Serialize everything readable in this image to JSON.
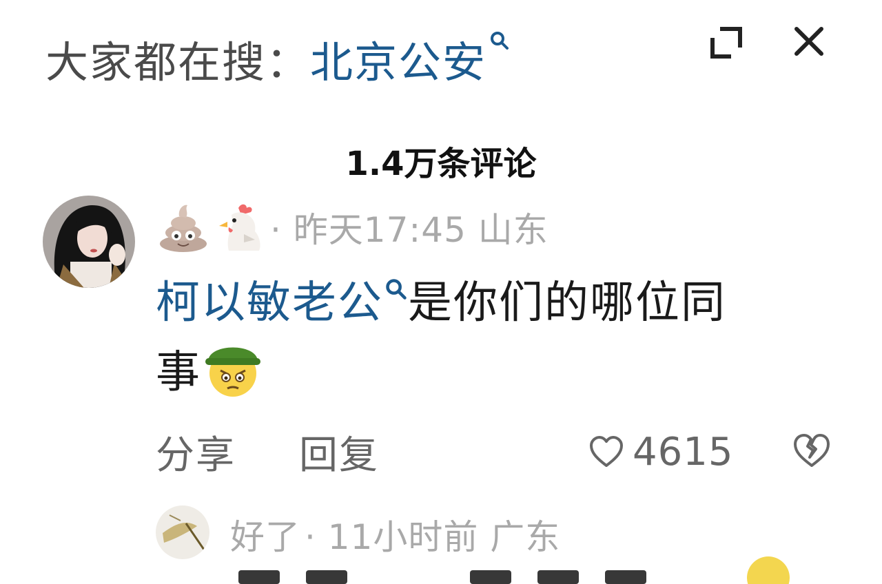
{
  "header": {
    "label": "大家都在搜：",
    "search_term": "北京公安"
  },
  "comments_header": {
    "count_text": "1.4万条评论"
  },
  "comments": [
    {
      "meta": "· 昨天17:45 山东",
      "body_link": "柯以敏老公",
      "body_text_1": "是你们的哪位同",
      "body_text_2": "事",
      "actions": {
        "share": "分享",
        "reply": "回复"
      },
      "likes": "4615"
    },
    {
      "username": "好了",
      "meta": "· 11小时前 广东"
    }
  ],
  "colors": {
    "link": "#1c5a8e",
    "meta": "#a9a9a9",
    "action": "#666666"
  },
  "icons": [
    "search-icon",
    "expand-icon",
    "close-icon",
    "poop-emoji-icon",
    "rooster-emoji-icon",
    "green-hat-emoji-icon",
    "heart-icon",
    "broken-heart-icon"
  ]
}
